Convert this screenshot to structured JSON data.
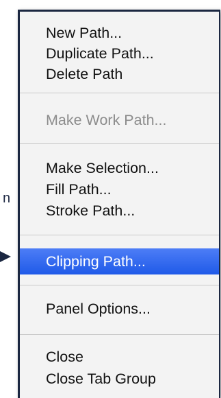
{
  "background": {
    "partial_label": "n"
  },
  "menu": {
    "items": [
      {
        "label": "New Path...",
        "enabled": true
      },
      {
        "label": "Duplicate Path...",
        "enabled": true
      },
      {
        "label": "Delete Path",
        "enabled": true
      },
      {
        "label": "Make Work Path...",
        "enabled": false
      },
      {
        "label": "Make Selection...",
        "enabled": true
      },
      {
        "label": "Fill Path...",
        "enabled": true
      },
      {
        "label": "Stroke Path...",
        "enabled": true
      },
      {
        "label": "Clipping Path...",
        "enabled": true,
        "highlighted": true
      },
      {
        "label": "Panel Options...",
        "enabled": true
      },
      {
        "label": "Close",
        "enabled": true
      },
      {
        "label": "Close Tab Group",
        "enabled": true
      }
    ]
  },
  "pointer_icon": "arrow-right-icon",
  "colors": {
    "highlight": "#2f66ee",
    "highlight_text": "#ffffff",
    "menu_background": "#f3f3f3",
    "disabled_text": "#8c8c8c",
    "frame_border": "#1b2741"
  }
}
